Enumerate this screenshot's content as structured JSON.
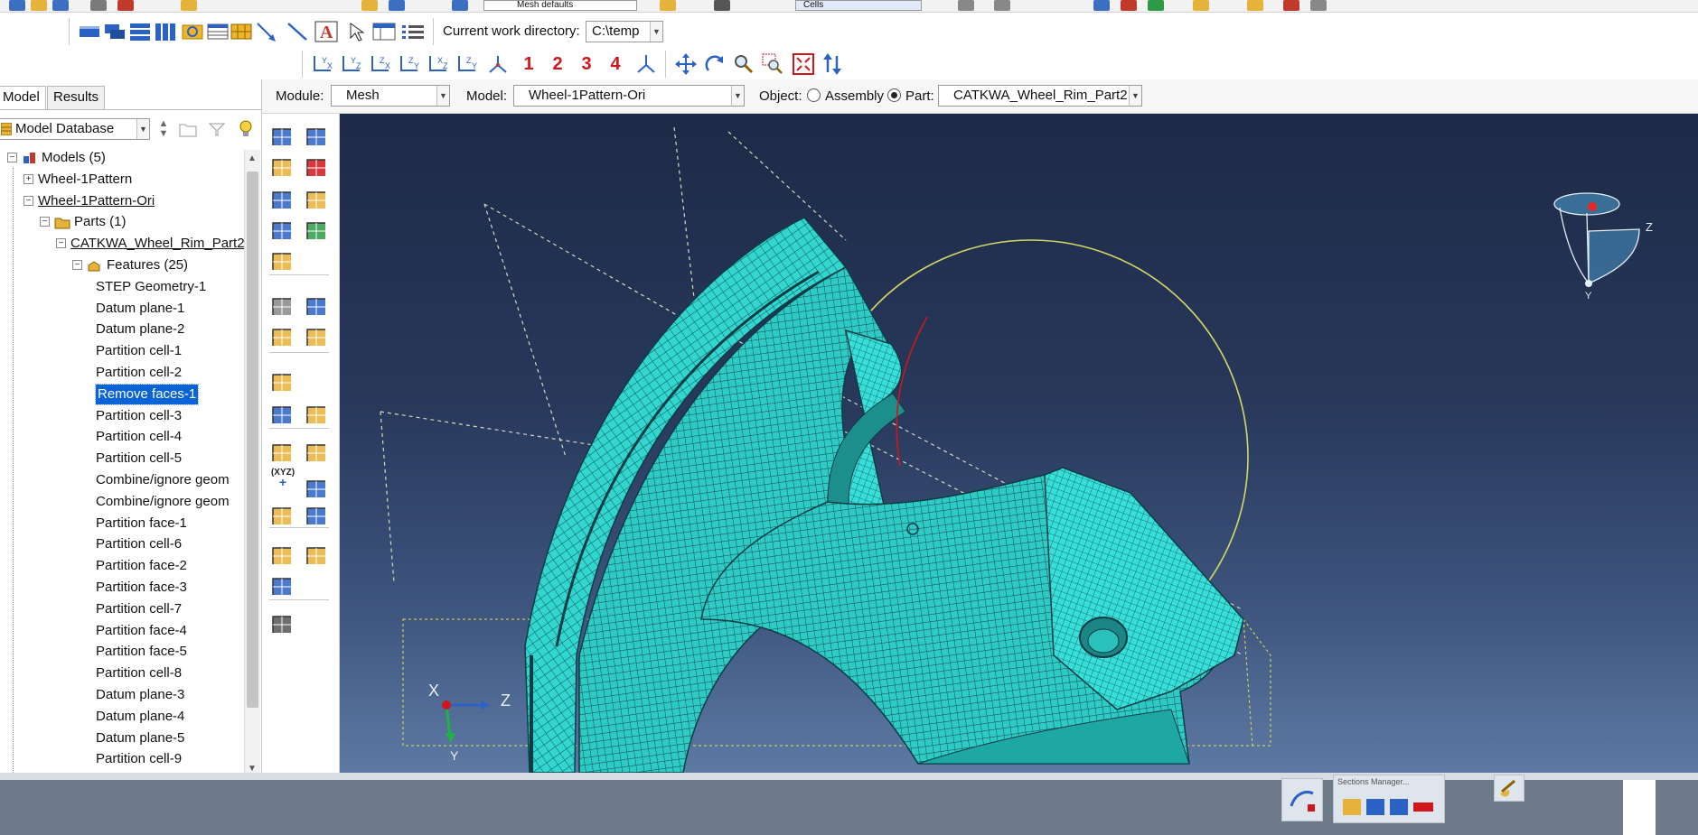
{
  "toolbar": {
    "row0_dropdowns": [
      "Mesh defaults",
      "Cells"
    ],
    "work_dir_label": "Current work directory:",
    "work_dir_value": "C:\\temp",
    "view_numbers": [
      "1",
      "2",
      "3",
      "4"
    ]
  },
  "module_bar": {
    "module_label": "Module:",
    "module_value": "Mesh",
    "model_label": "Model:",
    "model_value": "Wheel-1Pattern-Ori",
    "object_label": "Object:",
    "assembly_label": "Assembly",
    "part_label": "Part:",
    "part_value": "CATKWA_Wheel_Rim_Part2",
    "object_selected": "Part"
  },
  "left_panel": {
    "tabs": [
      "Model",
      "Results"
    ],
    "active_tab": "Model",
    "database_label": "Model Database",
    "tree": [
      {
        "label": "Models (5)",
        "level": 0
      },
      {
        "label": "Wheel-1Pattern",
        "level": 1
      },
      {
        "label": "Wheel-1Pattern-Ori",
        "level": 1
      },
      {
        "label": "Parts (1)",
        "level": 2
      },
      {
        "label": "CATKWA_Wheel_Rim_Part2",
        "level": 3
      },
      {
        "label": "Features (25)",
        "level": 4
      },
      {
        "label": "STEP Geometry-1",
        "level": 5
      },
      {
        "label": "Datum plane-1",
        "level": 5
      },
      {
        "label": "Datum plane-2",
        "level": 5
      },
      {
        "label": "Partition cell-1",
        "level": 5
      },
      {
        "label": "Partition cell-2",
        "level": 5
      },
      {
        "label": "Remove faces-1",
        "level": 5
      },
      {
        "label": "Partition cell-3",
        "level": 5
      },
      {
        "label": "Partition cell-4",
        "level": 5
      },
      {
        "label": "Partition cell-5",
        "level": 5
      },
      {
        "label": "Combine/ignore geom",
        "level": 5
      },
      {
        "label": "Combine/ignore geom",
        "level": 5
      },
      {
        "label": "Partition face-1",
        "level": 5
      },
      {
        "label": "Partition cell-6",
        "level": 5
      },
      {
        "label": "Partition face-2",
        "level": 5
      },
      {
        "label": "Partition face-3",
        "level": 5
      },
      {
        "label": "Partition cell-7",
        "level": 5
      },
      {
        "label": "Partition face-4",
        "level": 5
      },
      {
        "label": "Partition face-5",
        "level": 5
      },
      {
        "label": "Partition cell-8",
        "level": 5
      },
      {
        "label": "Datum plane-3",
        "level": 5
      },
      {
        "label": "Datum plane-4",
        "level": 5
      },
      {
        "label": "Datum plane-5",
        "level": 5
      },
      {
        "label": "Partition cell-9",
        "level": 5
      }
    ],
    "selected_item": "Remove faces-1"
  },
  "viewport": {
    "triad_labels": {
      "x": "X",
      "z": "Z",
      "y": "Y"
    },
    "view_cube_labels": {
      "z": "Z",
      "y": "Y"
    },
    "mesh_color": "#33d6cf",
    "background_top": "#1d2a47",
    "background_bottom": "#5d7aa4"
  },
  "palette": {
    "xyz_label": "(XYZ)"
  },
  "bottom": {
    "sections_manager_label": "Sections Manager..."
  }
}
